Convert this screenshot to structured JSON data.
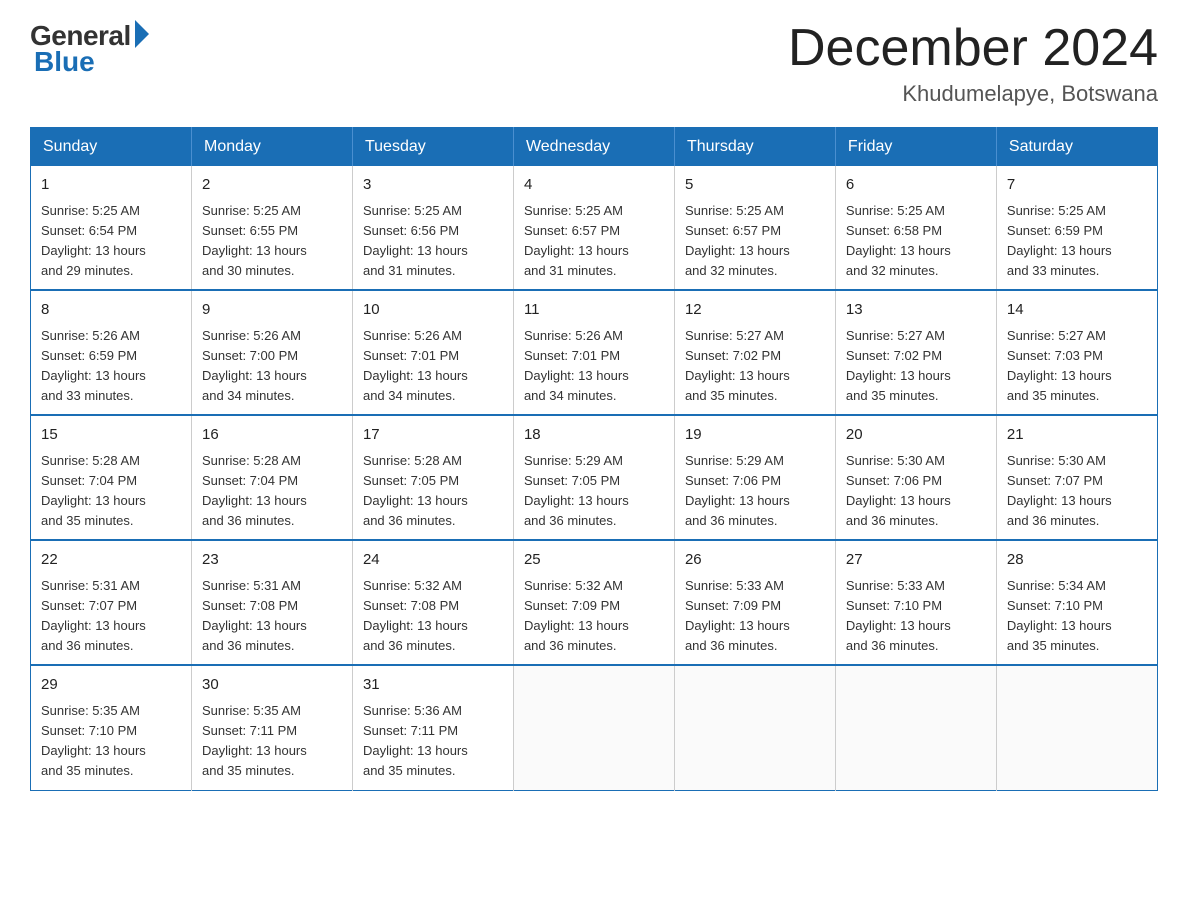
{
  "logo": {
    "general": "General",
    "blue": "Blue"
  },
  "title": "December 2024",
  "location": "Khudumelapye, Botswana",
  "days_of_week": [
    "Sunday",
    "Monday",
    "Tuesday",
    "Wednesday",
    "Thursday",
    "Friday",
    "Saturday"
  ],
  "weeks": [
    [
      {
        "day": "1",
        "sunrise": "5:25 AM",
        "sunset": "6:54 PM",
        "daylight": "13 hours and 29 minutes."
      },
      {
        "day": "2",
        "sunrise": "5:25 AM",
        "sunset": "6:55 PM",
        "daylight": "13 hours and 30 minutes."
      },
      {
        "day": "3",
        "sunrise": "5:25 AM",
        "sunset": "6:56 PM",
        "daylight": "13 hours and 31 minutes."
      },
      {
        "day": "4",
        "sunrise": "5:25 AM",
        "sunset": "6:57 PM",
        "daylight": "13 hours and 31 minutes."
      },
      {
        "day": "5",
        "sunrise": "5:25 AM",
        "sunset": "6:57 PM",
        "daylight": "13 hours and 32 minutes."
      },
      {
        "day": "6",
        "sunrise": "5:25 AM",
        "sunset": "6:58 PM",
        "daylight": "13 hours and 32 minutes."
      },
      {
        "day": "7",
        "sunrise": "5:25 AM",
        "sunset": "6:59 PM",
        "daylight": "13 hours and 33 minutes."
      }
    ],
    [
      {
        "day": "8",
        "sunrise": "5:26 AM",
        "sunset": "6:59 PM",
        "daylight": "13 hours and 33 minutes."
      },
      {
        "day": "9",
        "sunrise": "5:26 AM",
        "sunset": "7:00 PM",
        "daylight": "13 hours and 34 minutes."
      },
      {
        "day": "10",
        "sunrise": "5:26 AM",
        "sunset": "7:01 PM",
        "daylight": "13 hours and 34 minutes."
      },
      {
        "day": "11",
        "sunrise": "5:26 AM",
        "sunset": "7:01 PM",
        "daylight": "13 hours and 34 minutes."
      },
      {
        "day": "12",
        "sunrise": "5:27 AM",
        "sunset": "7:02 PM",
        "daylight": "13 hours and 35 minutes."
      },
      {
        "day": "13",
        "sunrise": "5:27 AM",
        "sunset": "7:02 PM",
        "daylight": "13 hours and 35 minutes."
      },
      {
        "day": "14",
        "sunrise": "5:27 AM",
        "sunset": "7:03 PM",
        "daylight": "13 hours and 35 minutes."
      }
    ],
    [
      {
        "day": "15",
        "sunrise": "5:28 AM",
        "sunset": "7:04 PM",
        "daylight": "13 hours and 35 minutes."
      },
      {
        "day": "16",
        "sunrise": "5:28 AM",
        "sunset": "7:04 PM",
        "daylight": "13 hours and 36 minutes."
      },
      {
        "day": "17",
        "sunrise": "5:28 AM",
        "sunset": "7:05 PM",
        "daylight": "13 hours and 36 minutes."
      },
      {
        "day": "18",
        "sunrise": "5:29 AM",
        "sunset": "7:05 PM",
        "daylight": "13 hours and 36 minutes."
      },
      {
        "day": "19",
        "sunrise": "5:29 AM",
        "sunset": "7:06 PM",
        "daylight": "13 hours and 36 minutes."
      },
      {
        "day": "20",
        "sunrise": "5:30 AM",
        "sunset": "7:06 PM",
        "daylight": "13 hours and 36 minutes."
      },
      {
        "day": "21",
        "sunrise": "5:30 AM",
        "sunset": "7:07 PM",
        "daylight": "13 hours and 36 minutes."
      }
    ],
    [
      {
        "day": "22",
        "sunrise": "5:31 AM",
        "sunset": "7:07 PM",
        "daylight": "13 hours and 36 minutes."
      },
      {
        "day": "23",
        "sunrise": "5:31 AM",
        "sunset": "7:08 PM",
        "daylight": "13 hours and 36 minutes."
      },
      {
        "day": "24",
        "sunrise": "5:32 AM",
        "sunset": "7:08 PM",
        "daylight": "13 hours and 36 minutes."
      },
      {
        "day": "25",
        "sunrise": "5:32 AM",
        "sunset": "7:09 PM",
        "daylight": "13 hours and 36 minutes."
      },
      {
        "day": "26",
        "sunrise": "5:33 AM",
        "sunset": "7:09 PM",
        "daylight": "13 hours and 36 minutes."
      },
      {
        "day": "27",
        "sunrise": "5:33 AM",
        "sunset": "7:10 PM",
        "daylight": "13 hours and 36 minutes."
      },
      {
        "day": "28",
        "sunrise": "5:34 AM",
        "sunset": "7:10 PM",
        "daylight": "13 hours and 35 minutes."
      }
    ],
    [
      {
        "day": "29",
        "sunrise": "5:35 AM",
        "sunset": "7:10 PM",
        "daylight": "13 hours and 35 minutes."
      },
      {
        "day": "30",
        "sunrise": "5:35 AM",
        "sunset": "7:11 PM",
        "daylight": "13 hours and 35 minutes."
      },
      {
        "day": "31",
        "sunrise": "5:36 AM",
        "sunset": "7:11 PM",
        "daylight": "13 hours and 35 minutes."
      },
      null,
      null,
      null,
      null
    ]
  ],
  "labels": {
    "sunrise": "Sunrise:",
    "sunset": "Sunset:",
    "daylight": "Daylight:"
  }
}
